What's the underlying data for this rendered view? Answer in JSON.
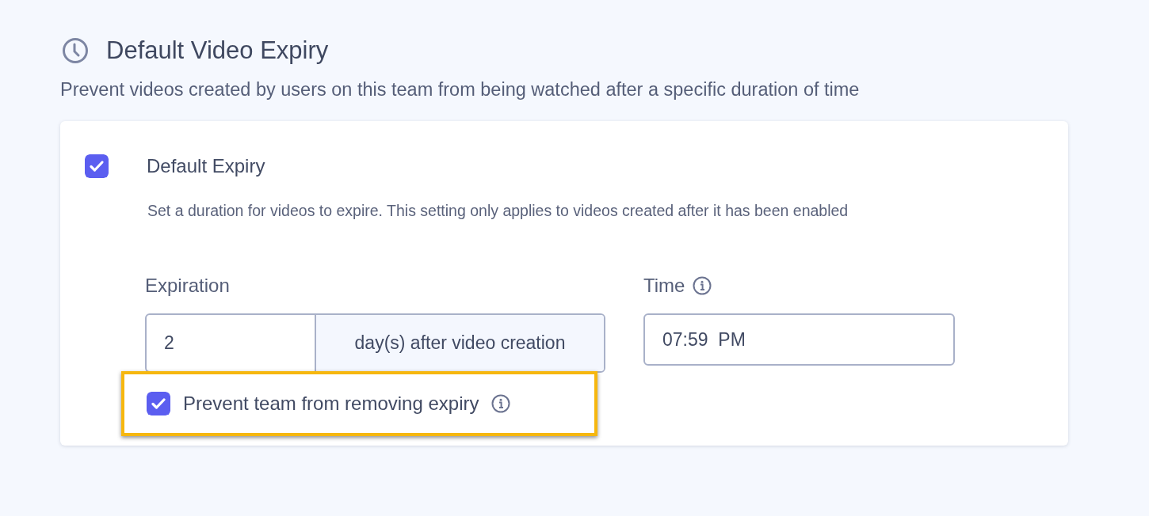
{
  "section": {
    "title": "Default Video Expiry",
    "description": "Prevent videos created by users on this team from being watched after a specific duration of time"
  },
  "card": {
    "option": {
      "label": "Default Expiry",
      "checked": true,
      "description": "Set a duration for videos to expire. This setting only applies to videos created after it has been enabled"
    },
    "expiration": {
      "label": "Expiration",
      "value": "2",
      "suffix": "day(s) after video creation"
    },
    "time": {
      "label": "Time",
      "value": "07:59  PM"
    },
    "lock": {
      "label": "Prevent team from removing expiry",
      "checked": true,
      "highlighted": true
    }
  }
}
